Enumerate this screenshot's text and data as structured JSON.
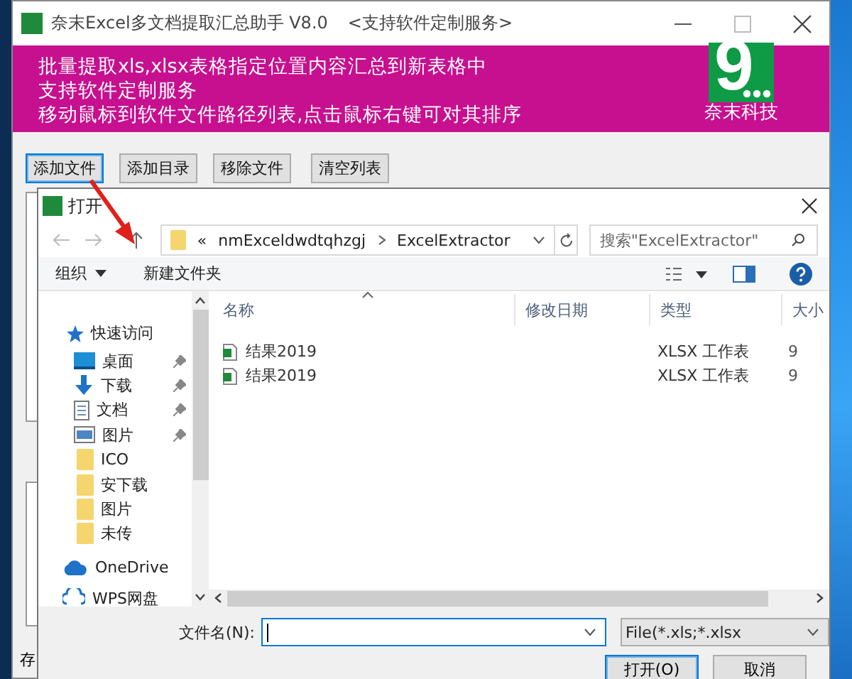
{
  "main_window": {
    "title": "奈末Excel多文档提取汇总助手 V8.0",
    "subtitle": "<支持软件定制服务>",
    "banner_lines": [
      "批量提取xls,xlsx表格指定位置内容汇总到新表格中",
      "支持软件定制服务",
      "移动鼠标到软件文件路径列表,点击鼠标右键可对其排序"
    ],
    "logo": {
      "mark": "9",
      "caption": "奈末科技"
    },
    "buttons": [
      {
        "label": "添加文件",
        "focused": true
      },
      {
        "label": "添加目录",
        "focused": false
      },
      {
        "label": "移除文件",
        "focused": false
      },
      {
        "label": "清空列表",
        "focused": false
      }
    ],
    "partial_label": "存"
  },
  "dialog": {
    "title": "打开",
    "overflow_marker": "«",
    "path": [
      "nmExceldwdtqhzgj",
      "ExcelExtractor"
    ],
    "search": {
      "placeholder": "搜索\"ExcelExtractor\""
    },
    "toolbar": {
      "organize": "组织",
      "new_folder": "新建文件夹"
    },
    "nav_items": [
      {
        "kind": "star",
        "label": "快速访问",
        "pinned": false
      },
      {
        "kind": "desktop",
        "label": "桌面",
        "pinned": true
      },
      {
        "kind": "download",
        "label": "下载",
        "pinned": true
      },
      {
        "kind": "document",
        "label": "文档",
        "pinned": true
      },
      {
        "kind": "image",
        "label": "图片",
        "pinned": true
      },
      {
        "kind": "folder",
        "label": "ICO",
        "pinned": false
      },
      {
        "kind": "folder",
        "label": "安下载",
        "pinned": false
      },
      {
        "kind": "folder",
        "label": "图片",
        "pinned": false
      },
      {
        "kind": "folder",
        "label": "未传",
        "pinned": false
      },
      {
        "kind": "cloud",
        "label": "OneDrive",
        "pinned": false
      },
      {
        "kind": "network",
        "label": "WPS网盘",
        "pinned": false
      }
    ],
    "columns": [
      "名称",
      "修改日期",
      "类型",
      "大小"
    ],
    "files": [
      {
        "name": "结果2019",
        "type": "XLSX 工作表",
        "size": "9"
      },
      {
        "name": "结果2019",
        "type": "XLSX 工作表",
        "size": "9"
      }
    ],
    "filename_label": "文件名(N):",
    "filter": "File(*.xls;*.xlsx",
    "buttons": [
      {
        "label": "打开(O)",
        "focused": true
      },
      {
        "label": "取消",
        "focused": false
      }
    ]
  }
}
